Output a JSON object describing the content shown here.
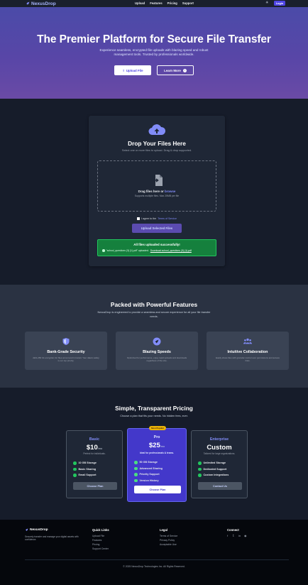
{
  "nav": {
    "brand": "NexusDrop",
    "links": [
      "Upload",
      "Features",
      "Pricing",
      "Support"
    ],
    "theme_icon": "sun-icon",
    "login": "Login"
  },
  "hero": {
    "title": "The Premier Platform for Secure File Transfer",
    "subtitle": "Experience seamless, encrypted file uploads with blazing speed and robust management tools. Trusted by professionals worldwide.",
    "upload_btn": "Upload File",
    "learn_btn": "Learn More"
  },
  "upload": {
    "title": "Drop Your Files Here",
    "subtitle": "Select one or more files to upload. Drag & drop supported.",
    "drop_text": "Drag files here or",
    "browse": "browse",
    "drop_sub": "Supports multiple files. Max 25MB per file",
    "terms_prefix": "I agree to the",
    "terms_link": "Terms of Service",
    "submit": "Upload Selected Files",
    "success_title": "All files uploaded successfully!",
    "success_file": "\"school_questions (3) (1).pdf\" uploaded.",
    "success_download": "Download school_questions (3) (1).pdf"
  },
  "features": {
    "title": "Packed with Powerful Features",
    "subtitle": "NexusDrop is engineered to provide a seamless and secure experience for all your file transfer needs.",
    "items": [
      {
        "icon": "shield-icon",
        "name": "Bank-Grade Security",
        "desc": "AES-256 bit encryption for files at rest and in transit. Your data's safety is our top priority."
      },
      {
        "icon": "rocket-icon",
        "name": "Blazing Speeds",
        "desc": "Optimized for performance, enjoy rapid uploads and downloads regardless of file size."
      },
      {
        "icon": "users-icon",
        "name": "Intuitive Collaboration",
        "desc": "Easily share files with granular control over permissions and access links."
      }
    ]
  },
  "pricing": {
    "title": "Simple, Transparent Pricing",
    "subtitle": "Choose a plan that fits your needs. No hidden fees, ever.",
    "plans": [
      {
        "name": "Basic",
        "price": "$10",
        "per": "/mo",
        "tag": "Perfect for individuals.",
        "features": [
          "10 GB Storage",
          "Basic Sharing",
          "Email Support"
        ],
        "button": "Choose Plan"
      },
      {
        "name": "Pro",
        "price": "$25",
        "per": "/mo",
        "tag": "Ideal for professionals & teams.",
        "badge": "Most Popular",
        "features": [
          "50 GB Storage",
          "Advanced Sharing",
          "Priority Support",
          "Version History"
        ],
        "button": "Choose Plan"
      },
      {
        "name": "Enterprise",
        "price": "Custom",
        "per": "",
        "tag": "Tailored for large organizations.",
        "features": [
          "Unlimited Storage",
          "Dedicated Support",
          "Custom Integrations"
        ],
        "button": "Contact Us"
      }
    ]
  },
  "footer": {
    "brand": "NexusDrop",
    "desc": "Securely transfer and manage your digital assets with confidence.",
    "quick_title": "Quick Links",
    "quick_links": [
      "Upload File",
      "Features",
      "Pricing",
      "Support Center"
    ],
    "legal_title": "Legal",
    "legal_links": [
      "Terms of Service",
      "Privacy Policy",
      "Acceptable Use"
    ],
    "connect_title": "Connect",
    "socials": [
      "facebook-icon",
      "twitter-icon",
      "linkedin-icon",
      "github-icon"
    ],
    "copyright": "© 2025 NexusDrop Technologies Inc. All Rights Reserved."
  },
  "colors": {
    "accent": "#4f46e5",
    "success": "#15803d",
    "popular": "#eab308"
  }
}
